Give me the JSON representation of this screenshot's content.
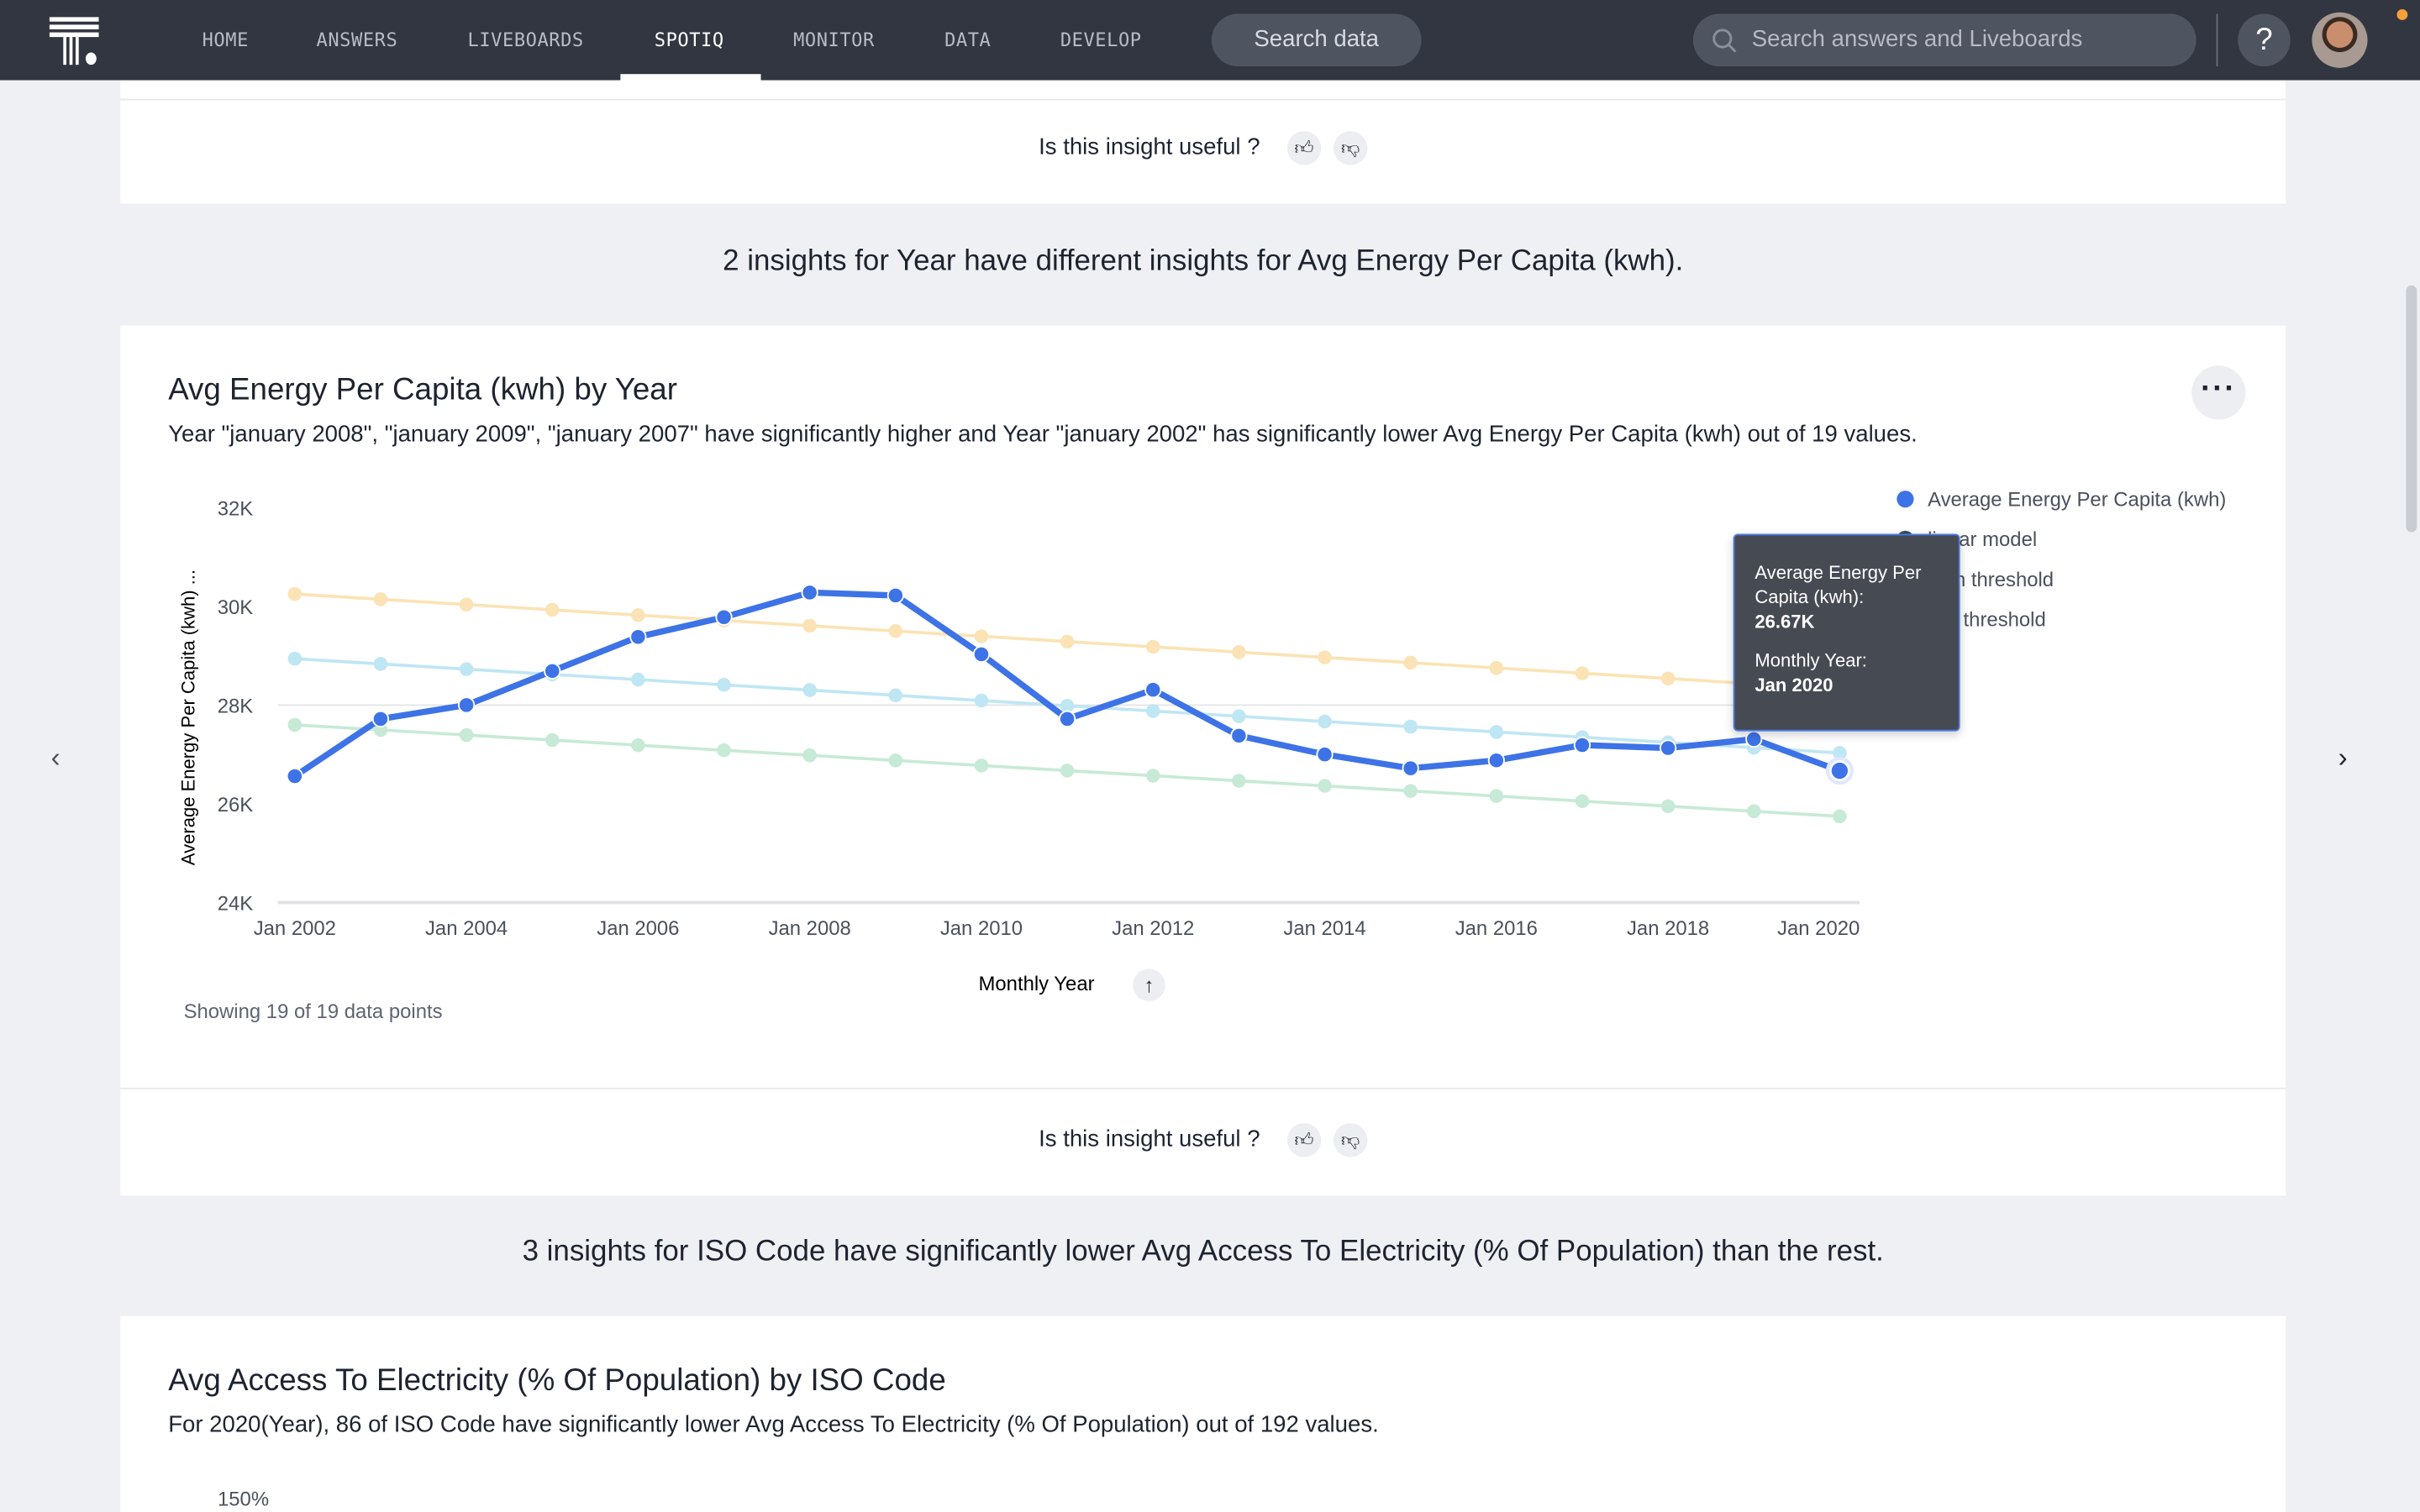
{
  "nav": {
    "items": [
      "HOME",
      "ANSWERS",
      "LIVEBOARDS",
      "SPOTIQ",
      "MONITOR",
      "DATA",
      "DEVELOP"
    ],
    "active": "SPOTIQ",
    "search_data": "Search data",
    "search_placeholder": "Search answers and Liveboards",
    "help": "?"
  },
  "feedback": {
    "question": "Is this insight useful ?",
    "thumbs_up_icon": "thumbs-up-icon",
    "thumbs_down_icon": "thumbs-down-icon"
  },
  "section1": {
    "heading": "2 insights for Year have different insights for Avg Energy Per Capita (kwh)."
  },
  "card1": {
    "title": "Avg Energy Per Capita (kwh) by Year",
    "description": "Year \"january 2008\", \"january 2009\", \"january 2007\" have significantly higher and Year \"january 2002\" has significantly lower Avg Energy Per Capita (kwh) out of 19 values.",
    "more_icon": "ellipsis-icon",
    "showing": "Showing 19 of 19 data points",
    "sort_icon": "arrow-up-icon"
  },
  "tooltip": {
    "label1": "Average Energy Per Capita (kwh):",
    "value1": "26.67K",
    "label2": "Monthly Year:",
    "value2": "Jan 2020"
  },
  "section2": {
    "heading": "3 insights for ISO Code have significantly lower Avg Access To Electricity (% Of Population) than the rest."
  },
  "card2": {
    "title": "Avg Access To Electricity (% Of Population) by ISO Code",
    "description": "For 2020(Year), 86 of ISO Code have significantly lower Avg Access To Electricity (% Of Population) out of 192 values.",
    "first_tick": "150%"
  },
  "chart_data": {
    "type": "line",
    "xlabel": "Monthly Year",
    "ylabel": "Average Energy Per Capita (kwh) ...",
    "ylim": [
      24000,
      32000
    ],
    "yticks": [
      "24K",
      "26K",
      "28K",
      "30K",
      "32K"
    ],
    "xticks": [
      "Jan 2002",
      "Jan 2004",
      "Jan 2006",
      "Jan 2008",
      "Jan 2010",
      "Jan 2012",
      "Jan 2014",
      "Jan 2016",
      "Jan 2018",
      "Jan 2020"
    ],
    "x": [
      2002,
      2003,
      2004,
      2005,
      2006,
      2007,
      2008,
      2009,
      2010,
      2011,
      2012,
      2013,
      2014,
      2015,
      2016,
      2017,
      2018,
      2019,
      2020
    ],
    "legend_position": "top-right",
    "series": [
      {
        "name": "Average Energy Per Capita (kwh)",
        "color": "#3d73e6",
        "values": [
          26560,
          27720,
          28000,
          28690,
          29380,
          29780,
          30280,
          30220,
          29030,
          27720,
          28310,
          27380,
          27000,
          26720,
          26880,
          27190,
          27130,
          27310,
          26670
        ]
      },
      {
        "name": "linear model",
        "color": "#bfe6f3",
        "values": [
          28940,
          28834,
          28728,
          28622,
          28516,
          28410,
          28304,
          28198,
          28092,
          27986,
          27880,
          27774,
          27668,
          27562,
          27456,
          27350,
          27244,
          27138,
          27030
        ]
      },
      {
        "name": "high threshold",
        "color": "#fbe3b5",
        "values": [
          30250,
          30143,
          30036,
          29929,
          29822,
          29715,
          29608,
          29501,
          29394,
          29287,
          29180,
          29073,
          28966,
          28859,
          28752,
          28645,
          28538,
          28431,
          28324
        ]
      },
      {
        "name": "low threshold",
        "color": "#c7ead6",
        "values": [
          27600,
          27497,
          27394,
          27291,
          27188,
          27085,
          26982,
          26879,
          26776,
          26673,
          26570,
          26467,
          26364,
          26261,
          26158,
          26055,
          25952,
          25849,
          25746
        ]
      }
    ],
    "highlighted": {
      "x": 2020,
      "value": 26670
    }
  }
}
